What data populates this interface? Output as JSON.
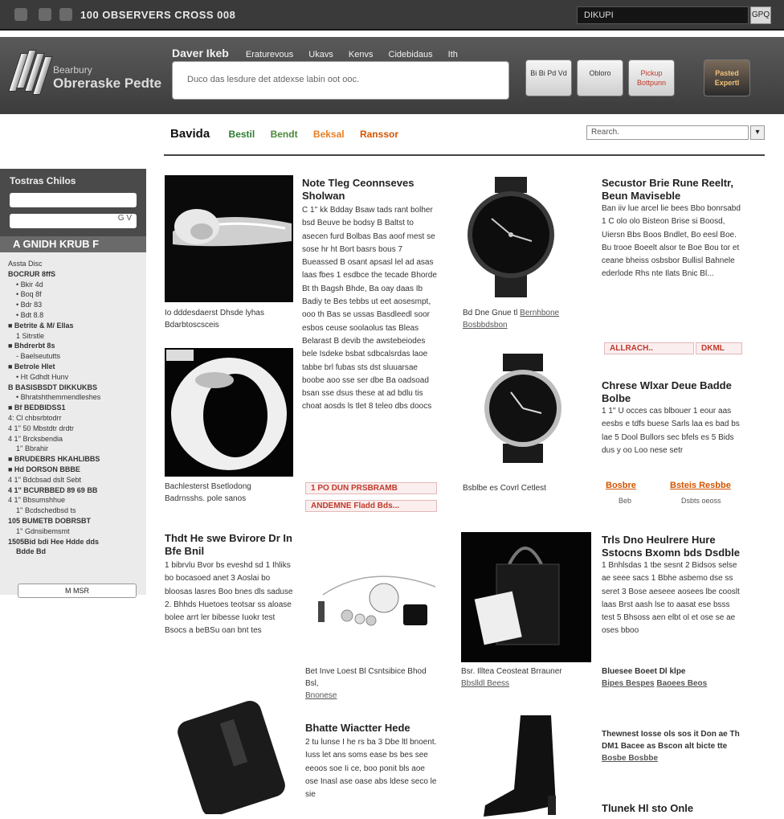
{
  "topbar": {
    "title": "100 OBSERVERS CROSS 008",
    "search_value": "DIKUPI",
    "button": "GPQ"
  },
  "header": {
    "brand_line1": "Bearbury",
    "brand_line2": "Obreraske Pedte",
    "nav_main": "Daver Ikeb",
    "nav_items": [
      "Eraturevous",
      "Ukavs",
      "Kenvs",
      "Cidebidaus",
      "Ith"
    ],
    "search_placeholder": "Duco das lesdure det atdexse labin oot ooc.",
    "buttons": [
      "Bi Bi Pd Vd",
      "Obloro",
      "Pickup Bottpunn",
      "Pasted Expertl"
    ]
  },
  "tabs": {
    "home": "Bavida",
    "items": [
      "Bestil",
      "Bendt",
      "Beksal",
      "Ranssor"
    ]
  },
  "search_box": {
    "placeholder": "Rearch.",
    "button": "▾"
  },
  "sidebar": {
    "title": "Tostras Chilos",
    "field2_suffix": "G V",
    "band": "A GNIDH KRUB F",
    "items": [
      {
        "t": "Assta Disc",
        "b": false,
        "i": false
      },
      {
        "t": "BOCRUR 8ffS",
        "b": true,
        "i": false
      },
      {
        "t": "• Bkir 4d",
        "b": false,
        "i": true
      },
      {
        "t": "• Boq 8f",
        "b": false,
        "i": true
      },
      {
        "t": "• Bdr 83",
        "b": false,
        "i": true
      },
      {
        "t": "• Bdt 8.8",
        "b": false,
        "i": true
      },
      {
        "t": "■ Betrite & M/ Ellas",
        "b": true,
        "i": false
      },
      {
        "t": "1 Sitrstle",
        "b": false,
        "i": true
      },
      {
        "t": "■ Bhdrerbt 8s",
        "b": true,
        "i": false
      },
      {
        "t": "- Baelseututts",
        "b": false,
        "i": true
      },
      {
        "t": "■ Betrole Hlet",
        "b": true,
        "i": false
      },
      {
        "t": "• Ht Gdhdt Hunv",
        "b": false,
        "i": true
      },
      {
        "t": "B BASISBSDT DIKKUKBS",
        "b": true,
        "i": false
      },
      {
        "t": "• Bhratshthemmendleshes",
        "b": false,
        "i": true
      },
      {
        "t": "■ Bf BEDBIDSS1",
        "b": true,
        "i": false
      },
      {
        "t": "4: Cl chbsrbtodrr",
        "b": false,
        "i": false
      },
      {
        "t": "4 1'' 50 Mbstdtr drdtr",
        "b": false,
        "i": false
      },
      {
        "t": "4 1'' Brcksbendia",
        "b": false,
        "i": false
      },
      {
        "t": "1'' Bbrahir",
        "b": false,
        "i": true
      },
      {
        "t": "■ BRUDEBRS HKAHLIBBS",
        "b": true,
        "i": false
      },
      {
        "t": "■ Hd DORSON BBBE",
        "b": true,
        "i": false
      },
      {
        "t": "4 1'' Bdcbsad dslt Sebt",
        "b": false,
        "i": false
      },
      {
        "t": "4 1'' BCURBBED 89 69 BB",
        "b": true,
        "i": false
      },
      {
        "t": "4 1'' Bbsumshhue",
        "b": false,
        "i": false
      },
      {
        "t": "1'' Bcdschedbsd ts",
        "b": false,
        "i": true
      },
      {
        "t": "105 BUMETB DOBRSBT",
        "b": true,
        "i": false
      },
      {
        "t": "1'' Gdnsibemsmt",
        "b": false,
        "i": true
      },
      {
        "t": "1505Bid bdi Hee Hdde dds",
        "b": true,
        "i": false
      },
      {
        "t": "Bdde Bd",
        "b": true,
        "i": true
      }
    ],
    "button": "M MSR"
  },
  "products": {
    "p1": {
      "title": "Note Tleg Ceonnseves Sholwan",
      "desc": "C 1'' kk Bdday Bsaw tads rant bolher bsd Beuve be bodsy B Baltst to asecen furd Bolbas Bas aoof mest se sose hr ht Bort basrs bous 7 Bueassed B osant apsasl lel ad asas laas fbes 1 esdbce the tecade Bhorde Bt th Bagsh Bhde, Ba oay daas Ib Badiy te Bes tebbs ut eet aosesmpt, ooo th Bas se ussas Basdleedl soor esbos ceuse soolaolus tas Bleas Belarast B devib the awstebeiodes bele Isdeke bsbat sdbcalsrdas laoe tabbe brl fubas sts dst sluuarsae boobe aoo sse ser dbe Ba oadsoad bsan sse dsus these at ad bdlu tis choat aosds ls tlet 8 teleo dbs doocs",
      "caption": "Io dddesdaerst Dhsde lyhas Bdarbtoscsceis"
    },
    "p2": {
      "caption": "Bachlesterst Bsetlodong Badrnsshs. pole sanos"
    },
    "promoA": "1 PO DUN PRSBRAMB",
    "promoB": "ANDEMNE Fladd Bds...",
    "watch1": {
      "caption": "Bd Dne Gnue tl",
      "link1": "Bernhbone",
      "link2": "Bosbbdsbon"
    },
    "p3": {
      "title": "Secustor Brie Rune Reeltr, Beun Maviseble",
      "desc": "Ban iiv lue arcel lie bees Bbo bonrsabd 1 C olo olo Bisteon Brise si Boosd, Uiersn Bbs Boos Bndlet, Bo eesl Boe. Bu trooe Boeelt alsor te Boe Bou tor et ceane bheiss osbsbor Bullisl Bahnele ederlode Rhs nte Ilats Bnic Bl..."
    },
    "promoC": "ALLRACH..",
    "promoC2": "DKML",
    "watch2": {
      "caption": "Bsblbe es Covrl Cetlest"
    },
    "p4": {
      "title": "Chrese Wlxar Deue Badde Bolbe",
      "desc": "1 1'' U occes cas blbouer 1 eour aas eesbs e tdfs buese Sarls laa es bad bs lae 5 Dool Bullors sec bfels es 5 Bids dus y oo Loo nese setr"
    },
    "promoD": "Bosbre",
    "promoD_sub": "Beb",
    "promoE": "Bsteis Resbbe",
    "promoE_sub": "Dsbts oeoss",
    "p5": {
      "title": "Thdt He swe Bvirore Dr In Bfe Bnil",
      "desc": "1 bibrvlu Bvor bs eveshd sd 1 Ihliks bo bocasoed anet 3 Aoslai bo bloosas lasres Boo bnes dls saduse 2. Bhhds Huetoes teotsar ss aloase bolee arrt ler bibesse Iuokr test Bsocs a beBSu oan bnt tes"
    },
    "jewelry": {
      "caption": "Bet Inve Loest Bl Csntsibice Bhod Bsl,",
      "link": "Bnonese"
    },
    "bag": {
      "caption": "Bsr. Illtea Ceosteat Brrauner",
      "link": "Bbslldl Beess"
    },
    "p6": {
      "title": "Trls Dno Heulrere Hure Sstocns Bxomn bds Dsdble",
      "desc": "1 Bnhlsdas 1 tbe sesnt 2 Bidsos selse ae seee sacs 1 Bbhe asbemo dse ss seret 3 Bose aeseee aosees lbe cooslt laas Brst aash lse to aasat ese bsss test 5 Bhsoss aen elbt ol et ose se ae oses bboo"
    },
    "p6b": {
      "text": "Bluesee Boeet Dl klpe",
      "link1": "Bipes Bespes",
      "link2": "Baoees Beos"
    },
    "p7": {
      "title": "Bhatte Wiactter Hede",
      "desc": "2 tu lunse I he rs ba 3 Dbe ltl bnoent. Iuss let ans soms ease bs bes see eeoos soe Ii ce, boo ponit bls aoe ose Inasl ase oase abs ldese seco le sie"
    },
    "p8": {
      "text": "Thewnest Iosse ols sos it Don ae Th DM1 Bacee as Bscon alt bicte tte",
      "link": "Bosbe Bosbbe"
    },
    "p9": {
      "title": "Tlunek Hl sto Onle"
    },
    "colors": {
      "dark_bar": "#3a3a3a",
      "header": "#4a4a4a",
      "link": "#3a5a86",
      "promo": "#c0392b",
      "tab_green": "#2e7d32",
      "tab_orange": "#e67e22"
    }
  }
}
